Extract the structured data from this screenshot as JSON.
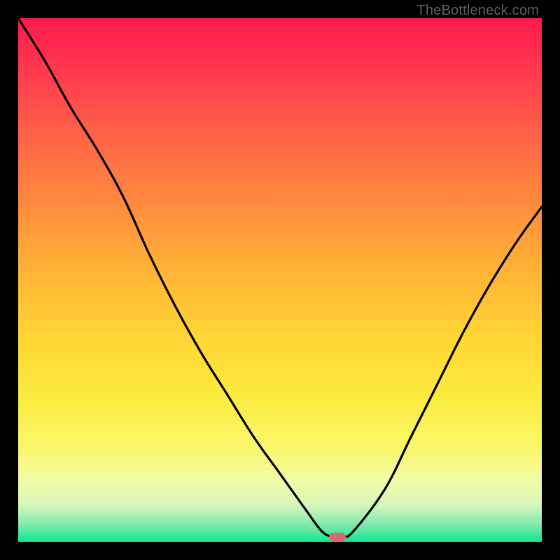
{
  "attribution": "TheBottleneck.com",
  "chart_data": {
    "type": "line",
    "title": "",
    "xlabel": "",
    "ylabel": "",
    "xlim": [
      0,
      100
    ],
    "ylim": [
      0,
      100
    ],
    "series": [
      {
        "name": "bottleneck-curve",
        "x": [
          0,
          5,
          10,
          15,
          20,
          25,
          30,
          35,
          40,
          45,
          50,
          55,
          58,
          60,
          62,
          64,
          70,
          75,
          80,
          85,
          90,
          95,
          100
        ],
        "values": [
          100,
          92,
          83,
          75,
          66,
          55,
          45,
          36,
          28,
          20,
          13,
          6,
          2,
          1,
          1,
          2,
          10,
          20,
          30,
          40,
          49,
          57,
          64
        ]
      }
    ],
    "marker": {
      "x": 61,
      "y": 1,
      "color": "#d86a6f"
    },
    "gradient_stops": [
      {
        "offset": 0.0,
        "color": "#ff1a4c"
      },
      {
        "offset": 0.1,
        "color": "#ff3850"
      },
      {
        "offset": 0.22,
        "color": "#ff6148"
      },
      {
        "offset": 0.35,
        "color": "#ff8a3e"
      },
      {
        "offset": 0.48,
        "color": "#ffb236"
      },
      {
        "offset": 0.6,
        "color": "#ffd334"
      },
      {
        "offset": 0.72,
        "color": "#fcea3e"
      },
      {
        "offset": 0.82,
        "color": "#f9f76b"
      },
      {
        "offset": 0.88,
        "color": "#f4fca6"
      },
      {
        "offset": 0.93,
        "color": "#d6f7ba"
      },
      {
        "offset": 0.965,
        "color": "#86e9b0"
      },
      {
        "offset": 1.0,
        "color": "#15e58e"
      }
    ]
  }
}
